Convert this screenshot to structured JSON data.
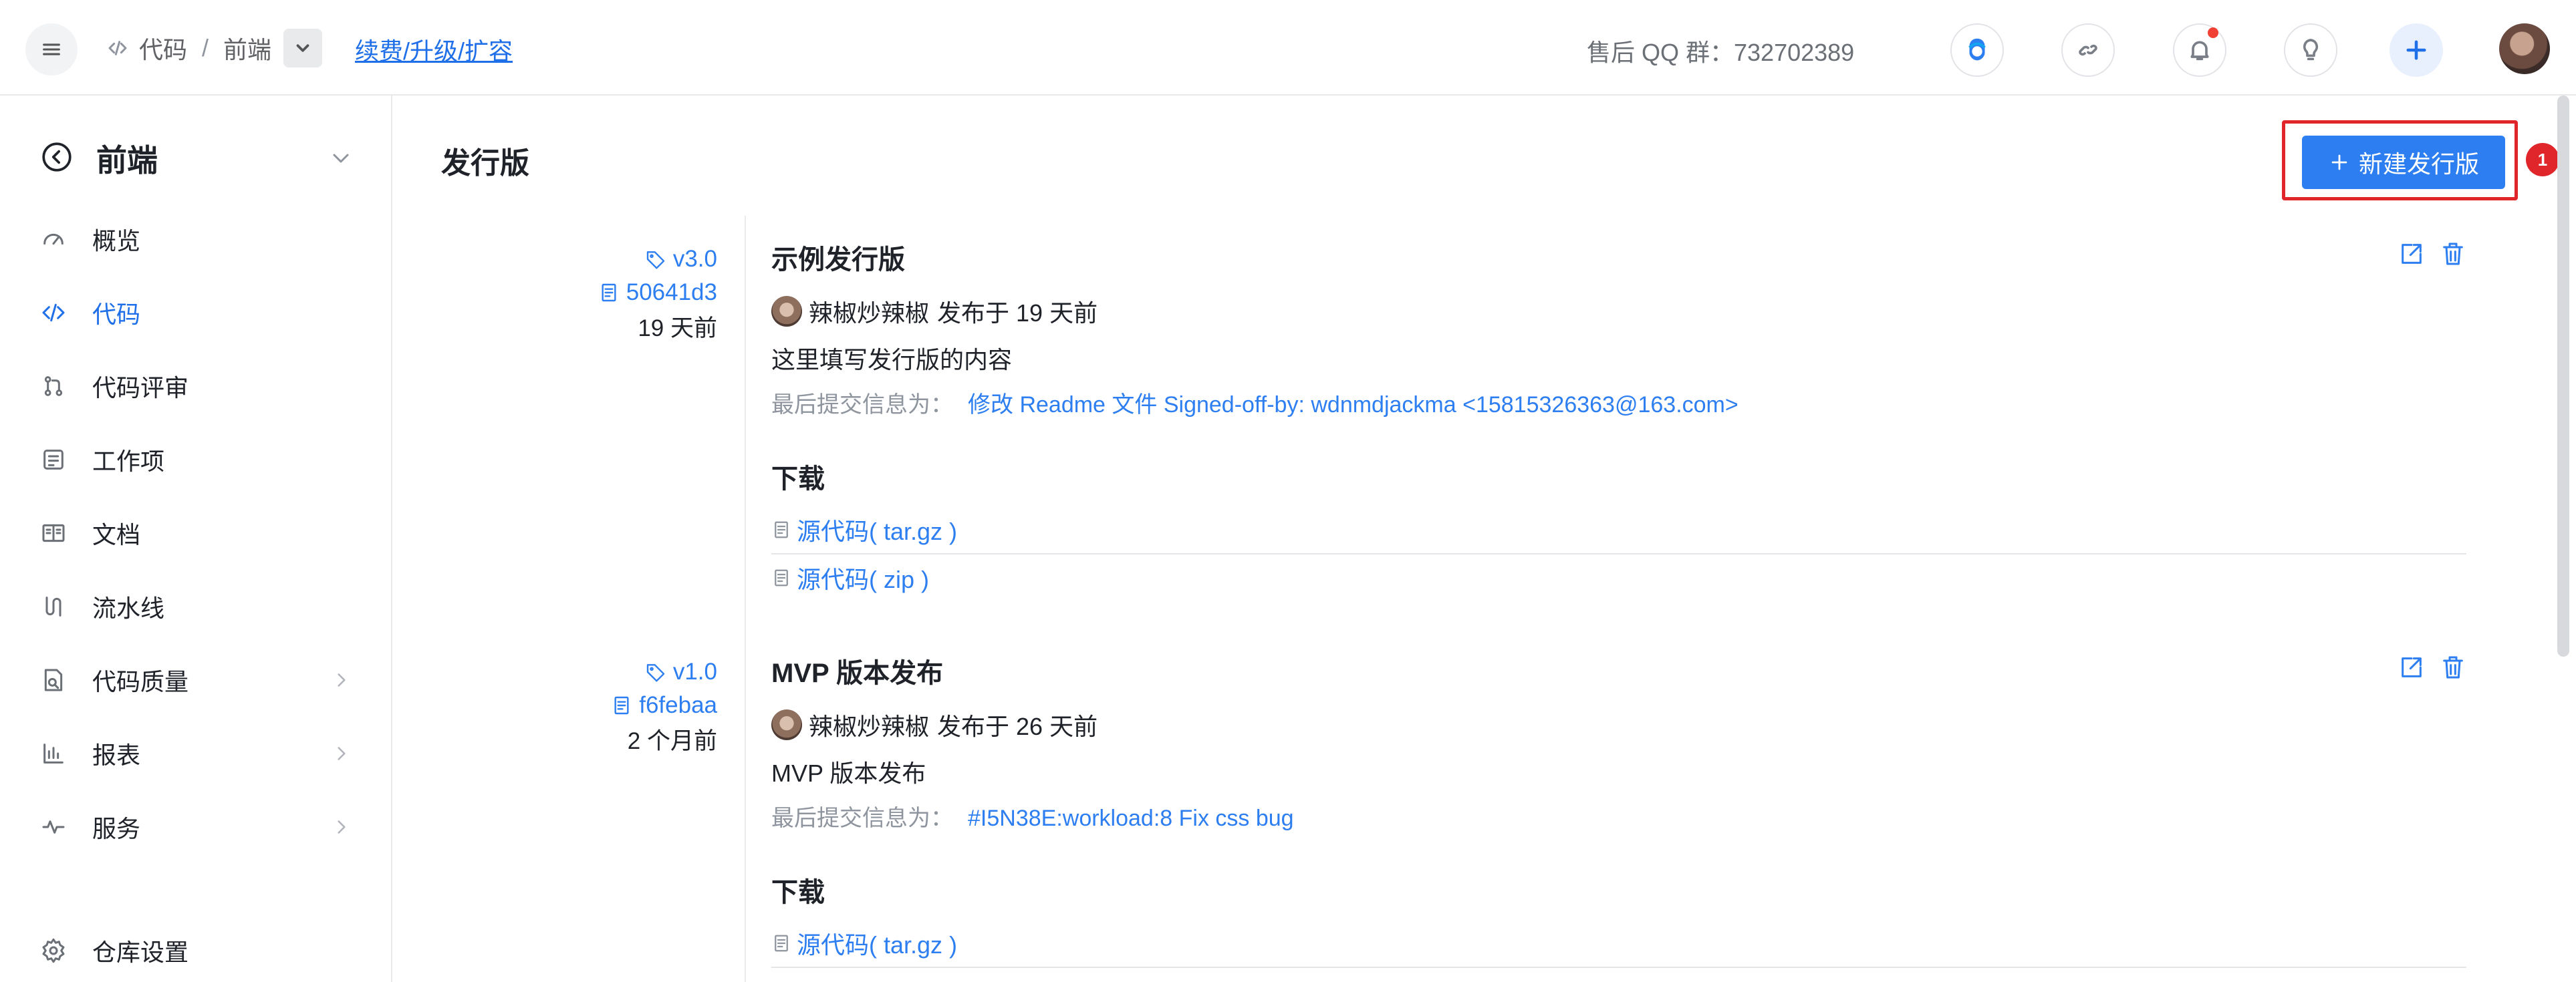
{
  "header": {
    "breadcrumbs": [
      "代码",
      "前端"
    ],
    "renew_link": "续费/升级/扩容",
    "qq_group": "售后 QQ 群：732702389",
    "icons": [
      "menu-icon",
      "code-icon",
      "chevron-down-icon",
      "assistant-icon",
      "link-icon",
      "bell-icon",
      "bulb-icon",
      "plus-icon",
      "avatar"
    ]
  },
  "sidebar": {
    "title": "前端",
    "items": [
      {
        "label": "概览",
        "icon": "dashboard-icon"
      },
      {
        "label": "代码",
        "icon": "code-icon",
        "active": true
      },
      {
        "label": "代码评审",
        "icon": "merge-icon"
      },
      {
        "label": "工作项",
        "icon": "task-icon"
      },
      {
        "label": "文档",
        "icon": "document-icon"
      },
      {
        "label": "流水线",
        "icon": "pipeline-icon"
      },
      {
        "label": "代码质量",
        "icon": "quality-icon",
        "has_arrow": true
      },
      {
        "label": "报表",
        "icon": "chart-icon",
        "has_arrow": true
      },
      {
        "label": "服务",
        "icon": "pulse-icon",
        "has_arrow": true
      },
      {
        "label": "仓库设置",
        "icon": "settings-icon"
      }
    ]
  },
  "main": {
    "title": "发行版",
    "new_button": "新建发行版",
    "annotation_badge": "1",
    "releases": [
      {
        "tag": "v3.0",
        "commit": "50641d3",
        "ago": "19 天前",
        "name": "示例发行版",
        "author": "辣椒炒辣椒",
        "published": "发布于 19 天前",
        "description": "这里填写发行版的内容",
        "last_commit_label": "最后提交信息为：",
        "last_commit": "修改 Readme 文件 Signed-off-by: wdnmdjackma <15815326363@163.com>",
        "download_title": "下载",
        "downloads": [
          "源代码( tar.gz )",
          "源代码( zip )"
        ]
      },
      {
        "tag": "v1.0",
        "commit": "f6febaa",
        "ago": "2 个月前",
        "name": "MVP 版本发布",
        "author": "辣椒炒辣椒",
        "published": "发布于 26 天前",
        "description": "MVP 版本发布",
        "last_commit_label": "最后提交信息为：",
        "last_commit": "#I5N38E:workload:8 Fix css bug",
        "download_title": "下载",
        "downloads": [
          "源代码( tar.gz )"
        ]
      }
    ]
  }
}
